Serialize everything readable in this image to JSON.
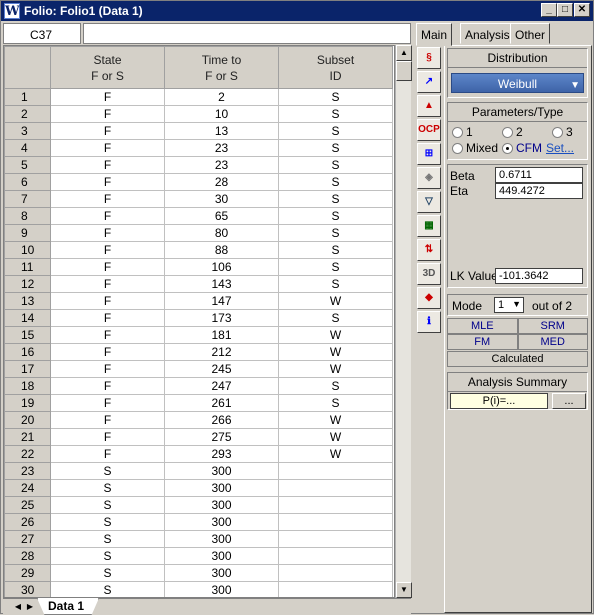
{
  "window": {
    "title": "Folio: Folio1 (Data 1)",
    "app_icon": "W",
    "min": "_",
    "max": "□",
    "close": "✕"
  },
  "refbar": {
    "cell": "C37",
    "formula": ""
  },
  "columns": [
    {
      "line1": "State",
      "line2": "F or S"
    },
    {
      "line1": "Time to",
      "line2": "F or S"
    },
    {
      "line1": "Subset",
      "line2": "ID"
    }
  ],
  "rows": [
    [
      "1",
      "F",
      "2",
      "S"
    ],
    [
      "2",
      "F",
      "10",
      "S"
    ],
    [
      "3",
      "F",
      "13",
      "S"
    ],
    [
      "4",
      "F",
      "23",
      "S"
    ],
    [
      "5",
      "F",
      "23",
      "S"
    ],
    [
      "6",
      "F",
      "28",
      "S"
    ],
    [
      "7",
      "F",
      "30",
      "S"
    ],
    [
      "8",
      "F",
      "65",
      "S"
    ],
    [
      "9",
      "F",
      "80",
      "S"
    ],
    [
      "10",
      "F",
      "88",
      "S"
    ],
    [
      "11",
      "F",
      "106",
      "S"
    ],
    [
      "12",
      "F",
      "143",
      "S"
    ],
    [
      "13",
      "F",
      "147",
      "W"
    ],
    [
      "14",
      "F",
      "173",
      "S"
    ],
    [
      "15",
      "F",
      "181",
      "W"
    ],
    [
      "16",
      "F",
      "212",
      "W"
    ],
    [
      "17",
      "F",
      "245",
      "W"
    ],
    [
      "18",
      "F",
      "247",
      "S"
    ],
    [
      "19",
      "F",
      "261",
      "S"
    ],
    [
      "20",
      "F",
      "266",
      "W"
    ],
    [
      "21",
      "F",
      "275",
      "W"
    ],
    [
      "22",
      "F",
      "293",
      "W"
    ],
    [
      "23",
      "S",
      "300",
      ""
    ],
    [
      "24",
      "S",
      "300",
      ""
    ],
    [
      "25",
      "S",
      "300",
      ""
    ],
    [
      "26",
      "S",
      "300",
      ""
    ],
    [
      "27",
      "S",
      "300",
      ""
    ],
    [
      "28",
      "S",
      "300",
      ""
    ],
    [
      "29",
      "S",
      "300",
      ""
    ],
    [
      "30",
      "S",
      "300",
      ""
    ]
  ],
  "sheet": {
    "tab": "Data 1"
  },
  "tabs": {
    "main": "Main",
    "analysis": "Analysis",
    "other": "Other"
  },
  "tools": [
    "wizard-icon",
    "plot-icon",
    "warning-icon",
    "ocp-icon",
    "grid-icon",
    "transform-icon",
    "filter-icon",
    "table-icon",
    "sort-icon",
    "3d-icon",
    "eraser-icon",
    "report-icon"
  ],
  "tools_text": {
    "ocp": "OCP",
    "three_d": "3D"
  },
  "distribution": {
    "title": "Distribution",
    "value": "Weibull"
  },
  "params": {
    "title": "Parameters/Type",
    "options": [
      "1",
      "2",
      "3"
    ],
    "mixed": "Mixed",
    "cfm": "CFM",
    "set": "Set...",
    "beta_label": "Beta",
    "beta": "0.6711",
    "eta_label": "Eta",
    "eta": "449.4272",
    "lk_label": "LK Value",
    "lk": "-101.3642"
  },
  "mode": {
    "label": "Mode",
    "value": "1",
    "of": "out of 2"
  },
  "methods": {
    "mle": "MLE",
    "srm": "SRM",
    "fm": "FM",
    "med": "MED",
    "calculated": "Calculated"
  },
  "summary": {
    "title": "Analysis Summary",
    "value": "P(i)=...",
    "more": "..."
  },
  "colors": {
    "title_bar": "#0a246a",
    "accent": "#3e63a8"
  }
}
